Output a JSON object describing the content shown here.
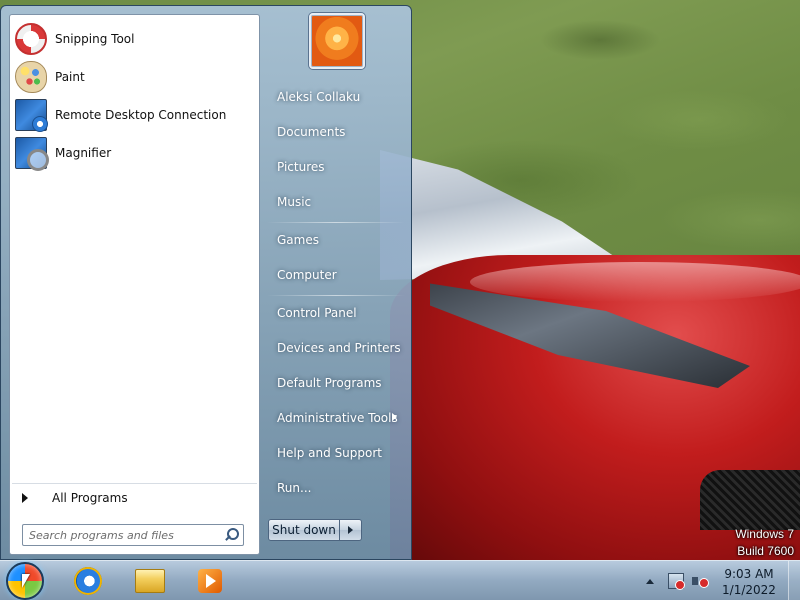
{
  "start_menu": {
    "pinned_programs": [
      {
        "label": "Snipping Tool",
        "icon": "scissors-icon"
      },
      {
        "label": "Paint",
        "icon": "paint-palette-icon"
      },
      {
        "label": "Remote Desktop Connection",
        "icon": "remote-desktop-icon"
      },
      {
        "label": "Magnifier",
        "icon": "magnifier-icon"
      }
    ],
    "all_programs_label": "All Programs",
    "search": {
      "placeholder": "Search programs and files"
    },
    "user_name": "Aleksi Collaku",
    "places": [
      {
        "label": "Documents"
      },
      {
        "label": "Pictures"
      },
      {
        "label": "Music"
      },
      {
        "label": "Games"
      },
      {
        "label": "Computer"
      },
      {
        "label": "Control Panel"
      },
      {
        "label": "Devices and Printers"
      },
      {
        "label": "Default Programs"
      },
      {
        "label": "Administrative Tools",
        "has_submenu": true
      },
      {
        "label": "Help and Support"
      },
      {
        "label": "Run..."
      }
    ],
    "shutdown_label": "Shut down"
  },
  "watermark": {
    "line1": "Windows 7",
    "line2": "Build 7600"
  },
  "taskbar": {
    "apps": [
      {
        "icon": "internet-explorer-icon"
      },
      {
        "icon": "windows-explorer-icon"
      },
      {
        "icon": "media-player-icon"
      }
    ],
    "tray_icons": [
      "show-hidden-icons-arrow",
      "network-icon",
      "volume-muted-icon"
    ],
    "clock": {
      "time": "9:03 AM",
      "date": "1/1/2022"
    }
  }
}
